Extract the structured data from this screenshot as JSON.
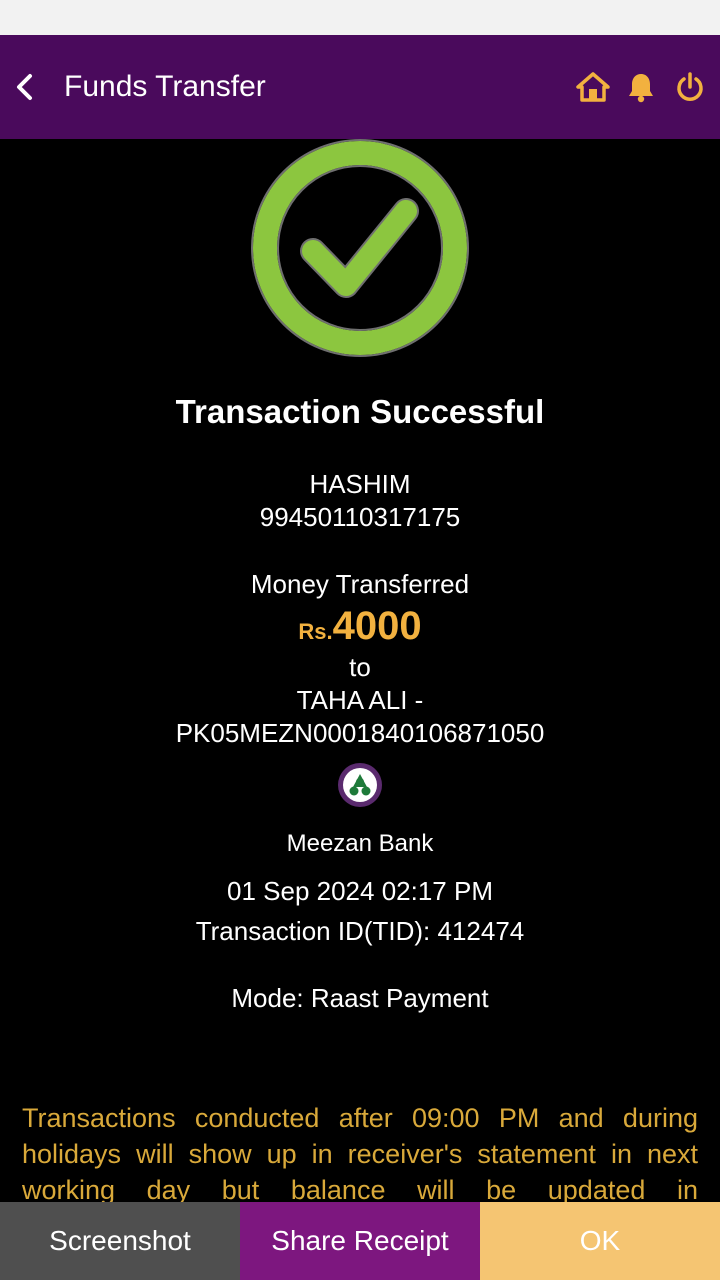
{
  "header": {
    "title": "Funds Transfer",
    "icons": [
      "back-icon",
      "home-icon",
      "bell-icon",
      "power-icon"
    ]
  },
  "colors": {
    "header_bg": "#4a0a5c",
    "accent": "#f2b13f",
    "success_green": "#8cc63f",
    "share_button": "#7d177f",
    "ok_button": "#f5c572",
    "screenshot_button": "#4f4f4f"
  },
  "result": {
    "title": "Transaction Successful",
    "sender_name": "HASHIM",
    "sender_account": "99450110317175",
    "money_label": "Money Transferred",
    "currency": "Rs.",
    "amount": "4000",
    "to_label": "to",
    "receiver_name": "TAHA ALI  -",
    "receiver_iban": "PK05MEZN0001840106871050",
    "bank_name": "Meezan Bank",
    "bank_logo_text": "MEEZAN BANK",
    "datetime": "01 Sep 2024   02:17 PM",
    "transaction_id": "Transaction ID(TID): 412474",
    "mode": "Mode: Raast Payment"
  },
  "notice": "Transactions conducted after 09:00 PM and during holidays will show up in receiver's statement in next working day but balance will be updated in",
  "footer": {
    "screenshot_label": "Screenshot",
    "share_label": "Share Receipt",
    "ok_label": "OK"
  }
}
